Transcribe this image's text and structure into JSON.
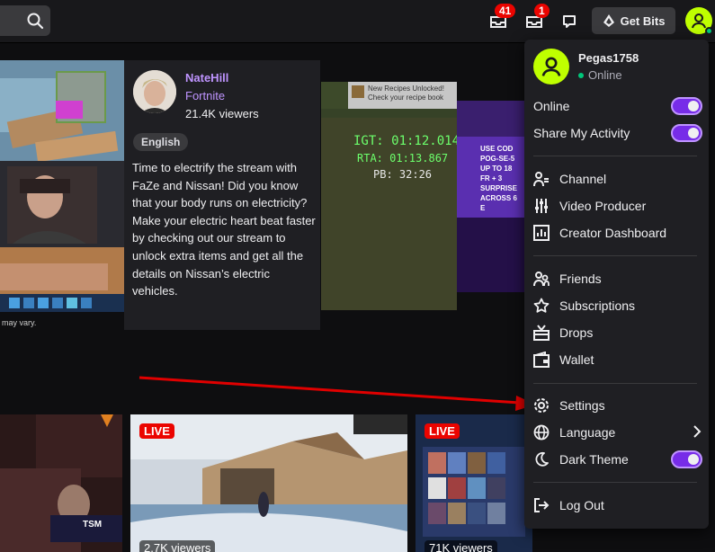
{
  "topbar": {
    "notifications_badge": "41",
    "whispers_badge": "1",
    "get_bits_label": "Get Bits"
  },
  "featured": {
    "streamer_name": "NateHill",
    "game": "Fortnite",
    "viewers": "21.4K viewers",
    "tag": "English",
    "description": "Time to electrify the stream with FaZe and Nissan! Did you know that your body runs on electricity? Make your electric heart beat faster by checking out our stream to unlock extra items and get all the details on Nissan’s electric vehicles.",
    "thumb_left_caption": "may vary.",
    "thumb_mid_text": {
      "unlock_title": "New Recipes Unlocked!",
      "unlock_sub": "Check your recipe book",
      "igt": "IGT: 01:12.014",
      "rta": "RTA: 01:13.867",
      "pb": "PB: 32:26"
    },
    "thumb_right_text": "USE COD POG-SE-5 UP TO 18 FR + 3 SURPRISE ACROSS 6 E"
  },
  "bottom_row": {
    "cards": [
      {
        "live": "",
        "viewers": "",
        "overlay": "TSM"
      },
      {
        "live": "LIVE",
        "viewers": "2.7K viewers"
      },
      {
        "live": "LIVE",
        "viewers": "71K viewers"
      }
    ]
  },
  "menu": {
    "username": "Pegas1758",
    "status": "Online",
    "items": [
      {
        "label": "Online",
        "icon": "none",
        "toggle": true
      },
      {
        "label": "Share My Activity",
        "icon": "none",
        "toggle": true
      },
      {
        "label": "Channel",
        "icon": "channel-icon"
      },
      {
        "label": "Video Producer",
        "icon": "sliders-icon"
      },
      {
        "label": "Creator Dashboard",
        "icon": "dashboard-icon"
      },
      {
        "label": "Friends",
        "icon": "friends-icon"
      },
      {
        "label": "Subscriptions",
        "icon": "star-icon"
      },
      {
        "label": "Drops",
        "icon": "drops-icon"
      },
      {
        "label": "Wallet",
        "icon": "wallet-icon"
      },
      {
        "label": "Settings",
        "icon": "gear-icon"
      },
      {
        "label": "Language",
        "icon": "globe-icon",
        "chevron": true
      },
      {
        "label": "Dark Theme",
        "icon": "moon-icon",
        "toggle": true
      },
      {
        "label": "Log Out",
        "icon": "logout-icon"
      }
    ]
  },
  "colors": {
    "accent": "#9147ff",
    "toggle_on": "#772ce8",
    "live_red": "#eb0400",
    "avatar_green": "#bfff00",
    "annotation_arrow": "#e00000"
  }
}
